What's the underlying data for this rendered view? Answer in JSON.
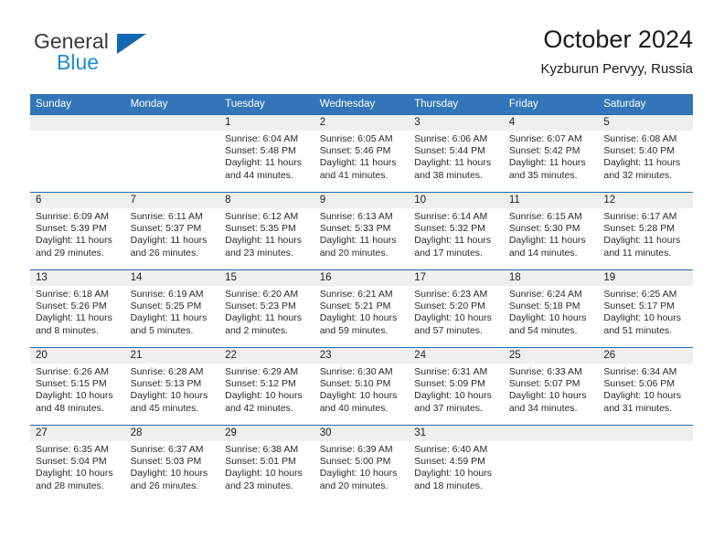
{
  "brand": {
    "line1": "General",
    "line2": "Blue",
    "triangle_color": "#1268b3",
    "blue_text_color": "#1c8ad6"
  },
  "header": {
    "title": "October 2024",
    "subtitle": "Kyzburun Pervyy, Russia",
    "accent_color": "#3275b8"
  },
  "calendar": {
    "weekday_headers": [
      "Sunday",
      "Monday",
      "Tuesday",
      "Wednesday",
      "Thursday",
      "Friday",
      "Saturday"
    ],
    "weeks": [
      [
        {
          "day": "",
          "lines": []
        },
        {
          "day": "",
          "lines": []
        },
        {
          "day": "1",
          "lines": [
            "Sunrise: 6:04 AM",
            "Sunset: 5:48 PM",
            "Daylight: 11 hours",
            "and 44 minutes."
          ]
        },
        {
          "day": "2",
          "lines": [
            "Sunrise: 6:05 AM",
            "Sunset: 5:46 PM",
            "Daylight: 11 hours",
            "and 41 minutes."
          ]
        },
        {
          "day": "3",
          "lines": [
            "Sunrise: 6:06 AM",
            "Sunset: 5:44 PM",
            "Daylight: 11 hours",
            "and 38 minutes."
          ]
        },
        {
          "day": "4",
          "lines": [
            "Sunrise: 6:07 AM",
            "Sunset: 5:42 PM",
            "Daylight: 11 hours",
            "and 35 minutes."
          ]
        },
        {
          "day": "5",
          "lines": [
            "Sunrise: 6:08 AM",
            "Sunset: 5:40 PM",
            "Daylight: 11 hours",
            "and 32 minutes."
          ]
        }
      ],
      [
        {
          "day": "6",
          "lines": [
            "Sunrise: 6:09 AM",
            "Sunset: 5:39 PM",
            "Daylight: 11 hours",
            "and 29 minutes."
          ]
        },
        {
          "day": "7",
          "lines": [
            "Sunrise: 6:11 AM",
            "Sunset: 5:37 PM",
            "Daylight: 11 hours",
            "and 26 minutes."
          ]
        },
        {
          "day": "8",
          "lines": [
            "Sunrise: 6:12 AM",
            "Sunset: 5:35 PM",
            "Daylight: 11 hours",
            "and 23 minutes."
          ]
        },
        {
          "day": "9",
          "lines": [
            "Sunrise: 6:13 AM",
            "Sunset: 5:33 PM",
            "Daylight: 11 hours",
            "and 20 minutes."
          ]
        },
        {
          "day": "10",
          "lines": [
            "Sunrise: 6:14 AM",
            "Sunset: 5:32 PM",
            "Daylight: 11 hours",
            "and 17 minutes."
          ]
        },
        {
          "day": "11",
          "lines": [
            "Sunrise: 6:15 AM",
            "Sunset: 5:30 PM",
            "Daylight: 11 hours",
            "and 14 minutes."
          ]
        },
        {
          "day": "12",
          "lines": [
            "Sunrise: 6:17 AM",
            "Sunset: 5:28 PM",
            "Daylight: 11 hours",
            "and 11 minutes."
          ]
        }
      ],
      [
        {
          "day": "13",
          "lines": [
            "Sunrise: 6:18 AM",
            "Sunset: 5:26 PM",
            "Daylight: 11 hours",
            "and 8 minutes."
          ]
        },
        {
          "day": "14",
          "lines": [
            "Sunrise: 6:19 AM",
            "Sunset: 5:25 PM",
            "Daylight: 11 hours",
            "and 5 minutes."
          ]
        },
        {
          "day": "15",
          "lines": [
            "Sunrise: 6:20 AM",
            "Sunset: 5:23 PM",
            "Daylight: 11 hours",
            "and 2 minutes."
          ]
        },
        {
          "day": "16",
          "lines": [
            "Sunrise: 6:21 AM",
            "Sunset: 5:21 PM",
            "Daylight: 10 hours",
            "and 59 minutes."
          ]
        },
        {
          "day": "17",
          "lines": [
            "Sunrise: 6:23 AM",
            "Sunset: 5:20 PM",
            "Daylight: 10 hours",
            "and 57 minutes."
          ]
        },
        {
          "day": "18",
          "lines": [
            "Sunrise: 6:24 AM",
            "Sunset: 5:18 PM",
            "Daylight: 10 hours",
            "and 54 minutes."
          ]
        },
        {
          "day": "19",
          "lines": [
            "Sunrise: 6:25 AM",
            "Sunset: 5:17 PM",
            "Daylight: 10 hours",
            "and 51 minutes."
          ]
        }
      ],
      [
        {
          "day": "20",
          "lines": [
            "Sunrise: 6:26 AM",
            "Sunset: 5:15 PM",
            "Daylight: 10 hours",
            "and 48 minutes."
          ]
        },
        {
          "day": "21",
          "lines": [
            "Sunrise: 6:28 AM",
            "Sunset: 5:13 PM",
            "Daylight: 10 hours",
            "and 45 minutes."
          ]
        },
        {
          "day": "22",
          "lines": [
            "Sunrise: 6:29 AM",
            "Sunset: 5:12 PM",
            "Daylight: 10 hours",
            "and 42 minutes."
          ]
        },
        {
          "day": "23",
          "lines": [
            "Sunrise: 6:30 AM",
            "Sunset: 5:10 PM",
            "Daylight: 10 hours",
            "and 40 minutes."
          ]
        },
        {
          "day": "24",
          "lines": [
            "Sunrise: 6:31 AM",
            "Sunset: 5:09 PM",
            "Daylight: 10 hours",
            "and 37 minutes."
          ]
        },
        {
          "day": "25",
          "lines": [
            "Sunrise: 6:33 AM",
            "Sunset: 5:07 PM",
            "Daylight: 10 hours",
            "and 34 minutes."
          ]
        },
        {
          "day": "26",
          "lines": [
            "Sunrise: 6:34 AM",
            "Sunset: 5:06 PM",
            "Daylight: 10 hours",
            "and 31 minutes."
          ]
        }
      ],
      [
        {
          "day": "27",
          "lines": [
            "Sunrise: 6:35 AM",
            "Sunset: 5:04 PM",
            "Daylight: 10 hours",
            "and 28 minutes."
          ]
        },
        {
          "day": "28",
          "lines": [
            "Sunrise: 6:37 AM",
            "Sunset: 5:03 PM",
            "Daylight: 10 hours",
            "and 26 minutes."
          ]
        },
        {
          "day": "29",
          "lines": [
            "Sunrise: 6:38 AM",
            "Sunset: 5:01 PM",
            "Daylight: 10 hours",
            "and 23 minutes."
          ]
        },
        {
          "day": "30",
          "lines": [
            "Sunrise: 6:39 AM",
            "Sunset: 5:00 PM",
            "Daylight: 10 hours",
            "and 20 minutes."
          ]
        },
        {
          "day": "31",
          "lines": [
            "Sunrise: 6:40 AM",
            "Sunset: 4:59 PM",
            "Daylight: 10 hours",
            "and 18 minutes."
          ]
        },
        {
          "day": "",
          "lines": []
        },
        {
          "day": "",
          "lines": []
        }
      ]
    ]
  }
}
